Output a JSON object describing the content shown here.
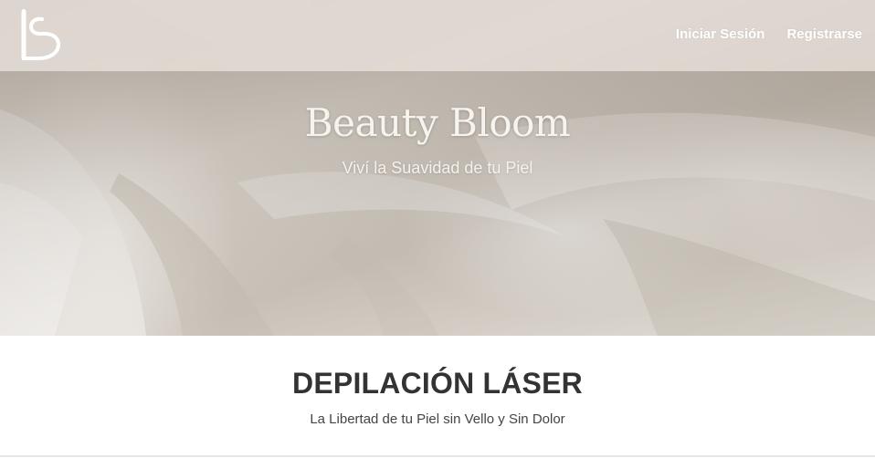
{
  "brand": {
    "logo_icon": "bs-monogram-icon"
  },
  "nav": {
    "login_label": "Iniciar Sesión",
    "register_label": "Registrarse"
  },
  "hero": {
    "title": "Beauty Bloom",
    "subtitle": "Viví la Suavidad de tu Piel"
  },
  "section": {
    "title": "DEPILACIÓN LÁSER",
    "subtitle": "La Libertad de tu Piel sin Vello y Sin Dolor"
  },
  "colors": {
    "nav_background": "#ded6d0",
    "hero_text": "#f7f4f0",
    "heading_text": "#333333",
    "body_text": "#444444"
  }
}
